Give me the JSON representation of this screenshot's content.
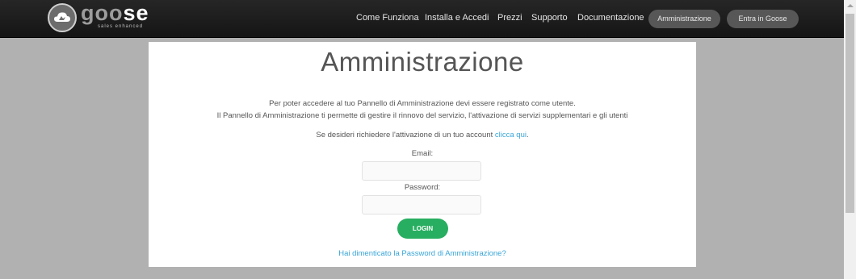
{
  "header": {
    "logo": {
      "word_light": "goo",
      "word_bold": "se",
      "tagline": "sales enhanced"
    },
    "nav": [
      {
        "label": "Come Funziona"
      },
      {
        "label": "Installa e Accedi"
      },
      {
        "label": "Prezzi"
      },
      {
        "label": "Supporto"
      },
      {
        "label": "Documentazione"
      }
    ],
    "admin_button": "Amministrazione",
    "enter_button": "Entra in Goose"
  },
  "panel": {
    "title": "Amministrazione",
    "intro_line1": "Per poter accedere al tuo Pannello di Amministrazione devi essere registrato come utente.",
    "intro_line2": "Il Pannello di Amministrazione ti permette di gestire il rinnovo del servizio, l'attivazione di servizi supplementari e gli utenti",
    "activation_text": "Se desideri richiedere l'attivazione di un tuo account ",
    "activation_link": "clicca qui",
    "activation_end": ".",
    "email_label": "Email:",
    "email_value": "",
    "password_label": "Password:",
    "password_value": "",
    "login_button": "LOGIN",
    "forgot_link": "Hai dimenticato la Password di Amministrazione?"
  },
  "colors": {
    "accent_link": "#3aa6d8",
    "login_green": "#27ae60",
    "topbar": "#1e1e1e",
    "page_bg": "#b1b1b1"
  }
}
